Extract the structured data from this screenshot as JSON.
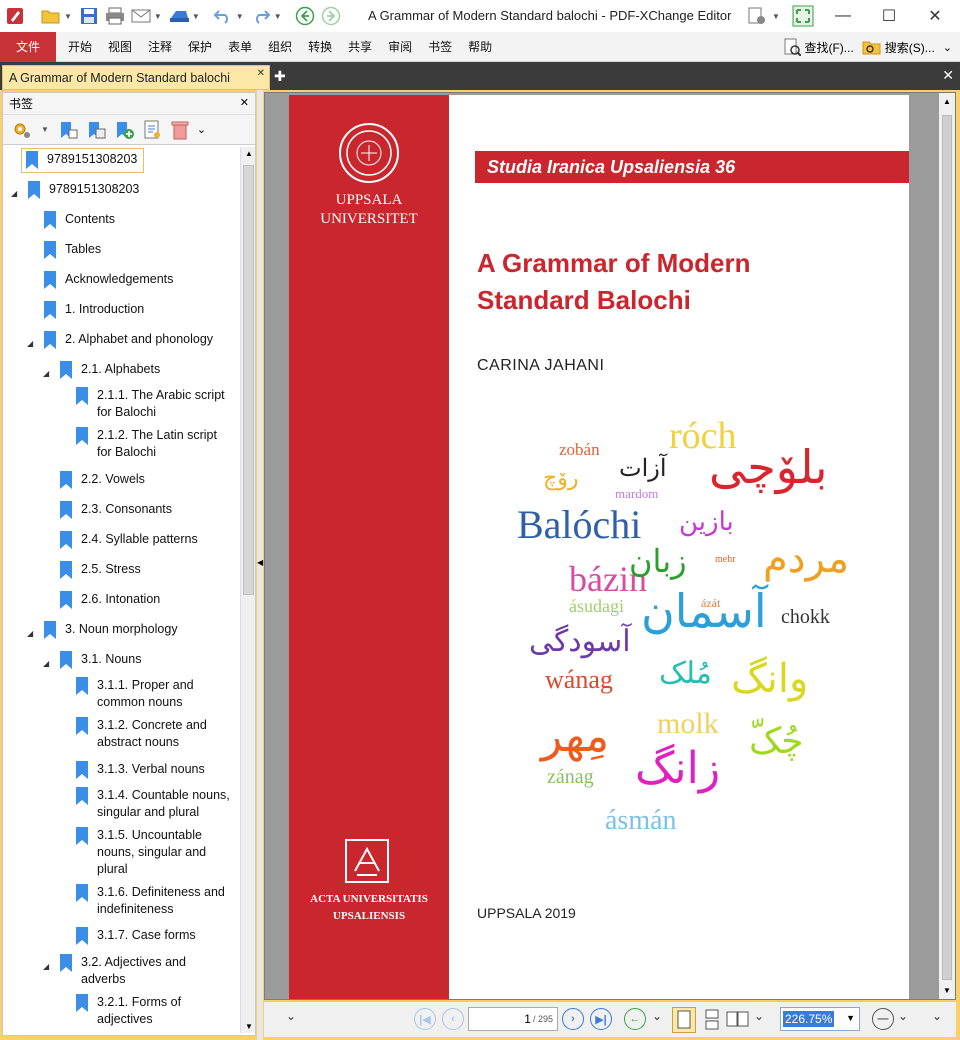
{
  "window": {
    "title": "A Grammar of Modern Standard balochi - PDF-XChange Editor"
  },
  "menu": {
    "file": "文件",
    "items": [
      "开始",
      "视图",
      "注释",
      "保护",
      "表单",
      "组织",
      "转换",
      "共享",
      "审阅",
      "书签",
      "帮助"
    ],
    "find": "查找(F)...",
    "search": "搜索(S)..."
  },
  "tabs": {
    "document_tab": "A Grammar of Modern Standard balochi"
  },
  "bookmarks": {
    "header": "书签",
    "items": [
      {
        "label": "9789151308203",
        "level": 0,
        "toggle": "",
        "selected": true
      },
      {
        "label": "9789151308203",
        "level": 0,
        "toggle": "expanded"
      },
      {
        "label": "Contents",
        "level": 1,
        "toggle": ""
      },
      {
        "label": "Tables",
        "level": 1,
        "toggle": ""
      },
      {
        "label": "Acknowledgements",
        "level": 1,
        "toggle": ""
      },
      {
        "label": "1. Introduction",
        "level": 1,
        "toggle": ""
      },
      {
        "label": "2. Alphabet and phonology",
        "level": 1,
        "toggle": "expanded"
      },
      {
        "label": "2.1. Alphabets",
        "level": 2,
        "toggle": "expanded"
      },
      {
        "label": "2.1.1. The Arabic script",
        "label2": "for Balochi",
        "level": 3,
        "toggle": ""
      },
      {
        "label": "2.1.2. The Latin script",
        "label2": "for Balochi",
        "level": 3,
        "toggle": ""
      },
      {
        "label": "2.2. Vowels",
        "level": 2,
        "toggle": ""
      },
      {
        "label": "2.3. Consonants",
        "level": 2,
        "toggle": ""
      },
      {
        "label": "2.4. Syllable patterns",
        "level": 2,
        "toggle": ""
      },
      {
        "label": "2.5. Stress",
        "level": 2,
        "toggle": ""
      },
      {
        "label": "2.6. Intonation",
        "level": 2,
        "toggle": ""
      },
      {
        "label": "3. Noun morphology",
        "level": 1,
        "toggle": "expanded"
      },
      {
        "label": "3.1. Nouns",
        "level": 2,
        "toggle": "expanded"
      },
      {
        "label": "3.1.1. Proper and",
        "label2": "common nouns",
        "level": 3,
        "toggle": ""
      },
      {
        "label": "3.1.2. Concrete and",
        "label2": "abstract nouns",
        "level": 3,
        "toggle": ""
      },
      {
        "label": "3.1.3. Verbal nouns",
        "level": 3,
        "toggle": ""
      },
      {
        "label": "3.1.4. Countable nouns,",
        "label2": "singular and plural",
        "level": 3,
        "toggle": ""
      },
      {
        "label": "3.1.5. Uncountable",
        "label2": "nouns, singular and",
        "label3": "plural",
        "level": 3,
        "toggle": ""
      },
      {
        "label": "3.1.6. Definiteness and",
        "label2": "indefiniteness",
        "level": 3,
        "toggle": ""
      },
      {
        "label": "3.1.7. Case forms",
        "level": 3,
        "toggle": ""
      },
      {
        "label": "3.2. Adjectives and",
        "label2": "adverbs",
        "level": 2,
        "toggle": "expanded"
      },
      {
        "label": "3.2.1. Forms of",
        "label2": "adjectives",
        "level": 3,
        "toggle": ""
      }
    ]
  },
  "cover": {
    "series": "Studia Iranica Upsaliensia 36",
    "university_line1": "UPPSALA",
    "university_line2": "UNIVERSITET",
    "title_line1": "A Grammar of Modern",
    "title_line2": "Standard Balochi",
    "author": "CARINA JAHANI",
    "acta_line1": "ACTA UNIVERSITATIS",
    "acta_line2": "UPSALIENSIS",
    "place_year": "UPPSALA 2019",
    "words": [
      {
        "t": "róch",
        "c": "#f2d13a"
      },
      {
        "t": "zobán",
        "c": "#e0623a"
      },
      {
        "t": "بلۆچی",
        "c": "#d9262e"
      },
      {
        "t": "آزات",
        "c": "#222222"
      },
      {
        "t": "رۆچ",
        "c": "#f0b020"
      },
      {
        "t": "mardom",
        "c": "#c77bd8"
      },
      {
        "t": "Balóchi",
        "c": "#2f5fa8"
      },
      {
        "t": "بازین",
        "c": "#c43ad0"
      },
      {
        "t": "mehr",
        "c": "#e06a2a"
      },
      {
        "t": "مردم",
        "c": "#f0a020"
      },
      {
        "t": "bázin",
        "c": "#d94aa0"
      },
      {
        "t": "زبان",
        "c": "#2aa02a"
      },
      {
        "t": "ásudagi",
        "c": "#9fcf6a"
      },
      {
        "t": "ázát",
        "c": "#e07a3a"
      },
      {
        "t": "آسمان",
        "c": "#2a9fd8"
      },
      {
        "t": "chokk",
        "c": "#333333"
      },
      {
        "t": "آسودگی",
        "c": "#6a3aa8"
      },
      {
        "t": "wánag",
        "c": "#d94a2a"
      },
      {
        "t": "مُلک",
        "c": "#20c0b0"
      },
      {
        "t": "وانگ",
        "c": "#d8d820"
      },
      {
        "t": "مِهر",
        "c": "#f05a1a"
      },
      {
        "t": "molk",
        "c": "#f0d060"
      },
      {
        "t": "چُکّ",
        "c": "#a0d820"
      },
      {
        "t": "zánag",
        "c": "#8ac060"
      },
      {
        "t": "زانگ",
        "c": "#e020c0"
      },
      {
        "t": "ásmán",
        "c": "#7fc0e8"
      }
    ]
  },
  "status": {
    "page_current": "1",
    "page_total": "/ 295",
    "zoom": "226.75%"
  },
  "colors": {
    "accent": "#c8333a",
    "tab_active": "#fbe7a6",
    "bookmark_blue": "#3b8ee8",
    "cover_red": "#c9262e"
  }
}
